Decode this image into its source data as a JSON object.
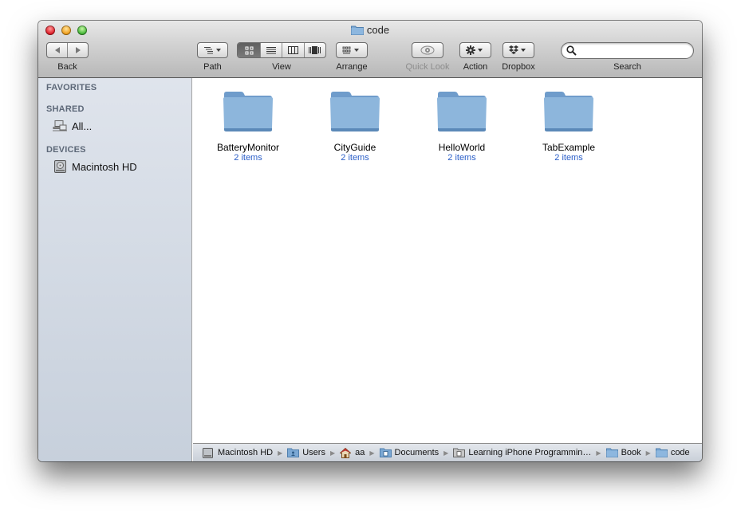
{
  "window": {
    "title": "code",
    "title_icon": "folder-icon"
  },
  "toolbar": {
    "back_label": "Back",
    "path_label": "Path",
    "view_label": "View",
    "arrange_label": "Arrange",
    "quicklook_label": "Quick Look",
    "action_label": "Action",
    "dropbox_label": "Dropbox",
    "search_label": "Search",
    "search_value": "",
    "search_placeholder": "",
    "view_modes": [
      "icon",
      "list",
      "column",
      "cover-flow"
    ],
    "active_view": "icon"
  },
  "sidebar": {
    "sections": [
      {
        "header": "FAVORITES",
        "items": []
      },
      {
        "header": "SHARED",
        "items": [
          {
            "label": "All...",
            "icon": "network-computer-icon"
          }
        ]
      },
      {
        "header": "DEVICES",
        "items": [
          {
            "label": "Macintosh HD",
            "icon": "hard-drive-icon"
          }
        ]
      }
    ]
  },
  "files": [
    {
      "name": "BatteryMonitor",
      "count": "2 items"
    },
    {
      "name": "CityGuide",
      "count": "2 items"
    },
    {
      "name": "HelloWorld",
      "count": "2 items"
    },
    {
      "name": "TabExample",
      "count": "2 items"
    }
  ],
  "pathbar": [
    {
      "label": "Macintosh HD",
      "icon": "hard-drive-icon"
    },
    {
      "label": "Users",
      "icon": "users-folder-icon"
    },
    {
      "label": "aa",
      "icon": "home-icon"
    },
    {
      "label": "Documents",
      "icon": "documents-folder-icon"
    },
    {
      "label": "Learning iPhone Programmin…",
      "icon": "folder-document-icon"
    },
    {
      "label": "Book",
      "icon": "folder-icon"
    },
    {
      "label": "code",
      "icon": "folder-icon"
    }
  ],
  "colors": {
    "item_count": "#2a5ec8",
    "sidebar_header": "#5d6878",
    "folder": "#7ba8d4"
  }
}
